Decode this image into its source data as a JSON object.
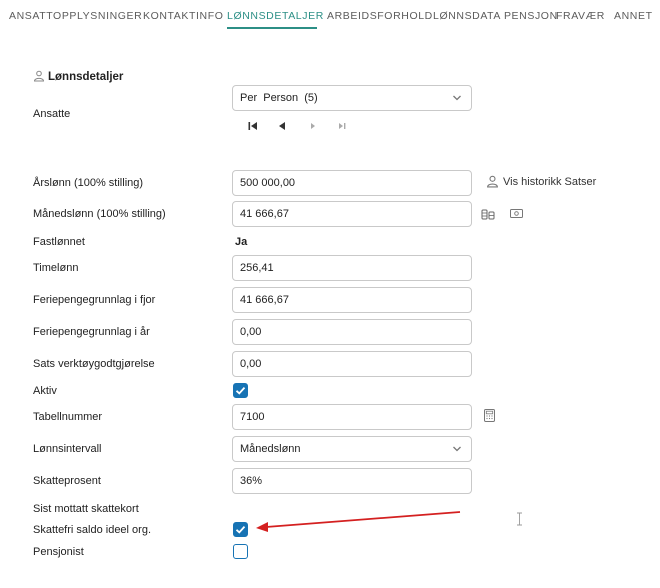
{
  "tabs": [
    {
      "label": "ANSATTOPPLYSNINGER",
      "active": false
    },
    {
      "label": "KONTAKTINFO",
      "active": false
    },
    {
      "label": "LØNNSDETALJER",
      "active": true
    },
    {
      "label": "ARBEIDSFORHOLD",
      "active": false
    },
    {
      "label": "LØNNSDATA PENSJON",
      "active": false
    },
    {
      "label": "FRAVÆR",
      "active": false
    },
    {
      "label": "ANNET",
      "active": false
    }
  ],
  "accent_color": "#2c8f86",
  "checkbox_color": "#1773b4",
  "arrow_color": "#d42020",
  "section": {
    "title": "Lønnsdetaljer",
    "icon": "person-icon"
  },
  "ansatte": {
    "label": "Ansatte",
    "selected": "Per  Person  (5)",
    "nav_icons": [
      "first-page-icon",
      "previous-icon",
      "next-icon",
      "last-page-icon"
    ]
  },
  "fields": {
    "arslonn": {
      "label": "Årslønn (100% stilling)",
      "value": "500 000,00"
    },
    "history_link": "Vis historikk Satser",
    "manedslonn": {
      "label": "Månedslønn (100% stilling)",
      "value": "41 666,67"
    },
    "fastlonnet": {
      "label": "Fastlønnet",
      "value": "Ja"
    },
    "timelonn": {
      "label": "Timelønn",
      "value": "256,41"
    },
    "feriepenger_fjor": {
      "label": "Feriepengegrunnlag i fjor",
      "value": "41 666,67"
    },
    "feriepenger_ar": {
      "label": "Feriepengegrunnlag i år",
      "value": "0,00"
    },
    "sats_verktoy": {
      "label": "Sats verktøygodtgjørelse",
      "value": "0,00"
    },
    "aktiv": {
      "label": "Aktiv",
      "checked": true
    },
    "tabellnummer": {
      "label": "Tabellnummer",
      "value": "7100"
    },
    "lonnsintervall": {
      "label": "Lønnsintervall",
      "value": "Månedslønn"
    },
    "skatteprosent": {
      "label": "Skatteprosent",
      "value": "36%"
    },
    "sist_mottatt": {
      "label": "Sist mottatt skattekort"
    },
    "skattefri": {
      "label": "Skattefri saldo ideel org.",
      "checked": true
    },
    "pensjonist": {
      "label": "Pensjonist",
      "checked": false
    }
  }
}
